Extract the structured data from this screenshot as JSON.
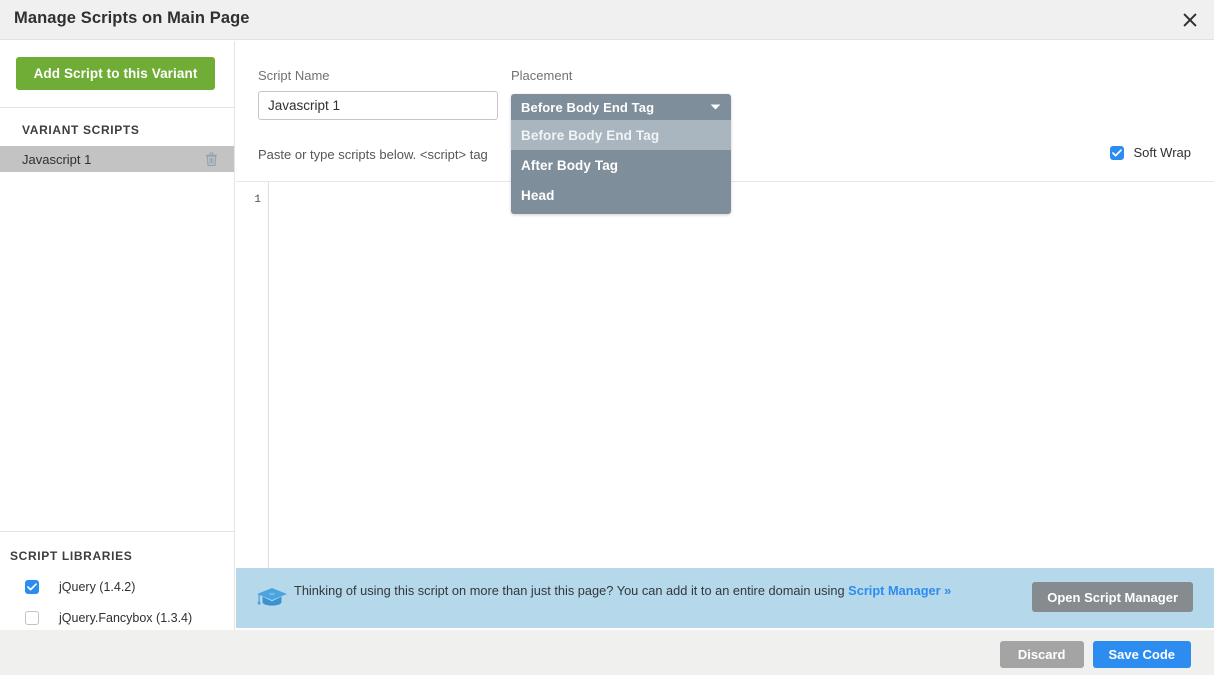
{
  "window": {
    "title": "Manage Scripts on Main Page",
    "close_icon": "close-icon"
  },
  "sidebar": {
    "add_script_button": "Add Script to this Variant",
    "variant_section_title": "VARIANT SCRIPTS",
    "variant_scripts": [
      {
        "label": "Javascript 1",
        "delete_icon": "trash-icon",
        "selected": true
      }
    ],
    "libraries_section_title": "SCRIPT LIBRARIES",
    "libraries": [
      {
        "label": "jQuery (1.4.2)",
        "checked": true
      },
      {
        "label": "jQuery.Fancybox (1.3.4)",
        "checked": false
      }
    ]
  },
  "main": {
    "script_name_label": "Script Name",
    "script_name_value": "Javascript 1",
    "script_name_placeholder": "Script Name",
    "placement_label": "Placement",
    "hint_text": "Paste or type scripts below. <script> tag",
    "soft_wrap_label": "Soft Wrap",
    "soft_wrap_checked": true,
    "placement_dropdown": {
      "selected": "Before Body End Tag",
      "caret_icon": "chevron-down-icon",
      "open": true,
      "options": [
        {
          "label": "Before Body End Tag",
          "highlighted": true
        },
        {
          "label": "After Body Tag",
          "highlighted": false
        },
        {
          "label": "Head",
          "highlighted": false
        }
      ]
    },
    "editor": {
      "line_numbers": [
        "1"
      ],
      "code_value": ""
    }
  },
  "banner": {
    "icon": "graduation-cap-icon",
    "text_part_1": "Thinking of using this script on more than just this page? You can add it to an entire domain using ",
    "link_text": "Script Manager »",
    "button_label": "Open Script Manager"
  },
  "footer": {
    "discard_label": "Discard",
    "save_label": "Save Code"
  },
  "colors": {
    "accent_blue": "#2d8cf0",
    "green": "#6fad36",
    "dropdown_bg": "#7e8e9b",
    "dropdown_highlight": "#a9b6bf",
    "banner_bg": "#b5d8ea",
    "titlebar_bg": "#f0f0f0",
    "footer_bg": "#f0f0ee",
    "selected_row": "#c3c3c3"
  }
}
